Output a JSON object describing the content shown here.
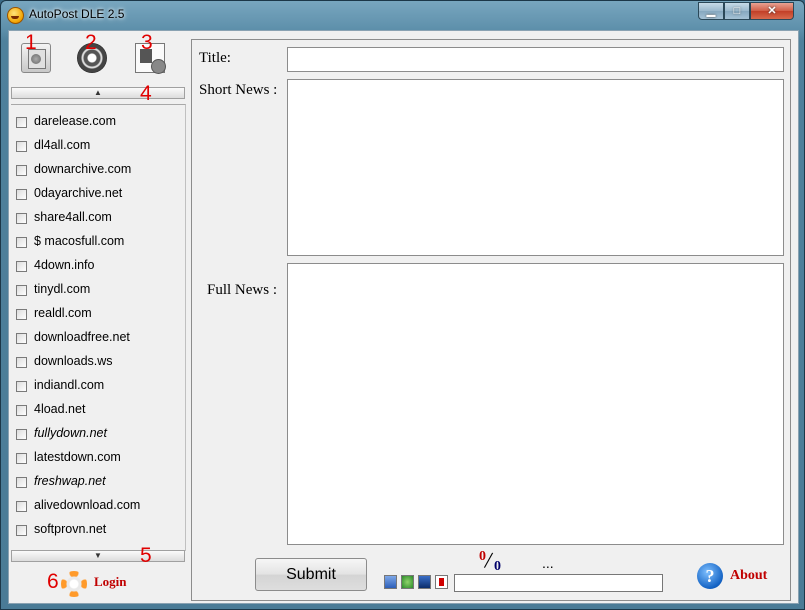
{
  "window": {
    "title": "AutoPost DLE 2.5",
    "minimize": "▁",
    "maximize": "□",
    "close": "✕"
  },
  "toolbar": {
    "buttons": [
      {
        "number": "1",
        "icon": "printer-icon"
      },
      {
        "number": "2",
        "icon": "film-reel-icon"
      },
      {
        "number": "3",
        "icon": "document-play-icon"
      }
    ],
    "scroll_up_number": "4",
    "scroll_down_number": "5",
    "login_number": "6",
    "scroll_up_glyph": "▲",
    "scroll_down_glyph": "▼"
  },
  "sites": [
    {
      "label": "darelease.com",
      "checked": false,
      "italic": false
    },
    {
      "label": "dl4all.com",
      "checked": false,
      "italic": false
    },
    {
      "label": "downarchive.com",
      "checked": false,
      "italic": false
    },
    {
      "label": "0dayarchive.net",
      "checked": false,
      "italic": false
    },
    {
      "label": "share4all.com",
      "checked": false,
      "italic": false
    },
    {
      "label": "$ macosfull.com",
      "checked": false,
      "italic": false
    },
    {
      "label": "4down.info",
      "checked": false,
      "italic": false
    },
    {
      "label": "tinydl.com",
      "checked": false,
      "italic": false
    },
    {
      "label": "realdl.com",
      "checked": false,
      "italic": false
    },
    {
      "label": "downloadfree.net",
      "checked": false,
      "italic": false
    },
    {
      "label": "downloads.ws",
      "checked": false,
      "italic": false
    },
    {
      "label": "indiandl.com",
      "checked": false,
      "italic": false
    },
    {
      "label": "4load.net",
      "checked": false,
      "italic": false
    },
    {
      "label": "fullydown.net",
      "checked": false,
      "italic": true
    },
    {
      "label": "latestdown.com",
      "checked": false,
      "italic": false
    },
    {
      "label": "freshwap.net",
      "checked": false,
      "italic": true
    },
    {
      "label": "alivedownload.com",
      "checked": false,
      "italic": false
    },
    {
      "label": "softprovn.net",
      "checked": false,
      "italic": false
    }
  ],
  "login": {
    "label": "Login"
  },
  "form": {
    "title_label": "Title:",
    "title_value": "",
    "short_news_label": "Short News :",
    "short_news_value": "",
    "full_news_label": "Full News :",
    "full_news_value": ""
  },
  "footer": {
    "submit_label": "Submit",
    "count_done": "0",
    "count_total": "0",
    "count_separator": "/",
    "status": "...",
    "progress": 0,
    "about_label": "About",
    "about_glyph": "?"
  }
}
